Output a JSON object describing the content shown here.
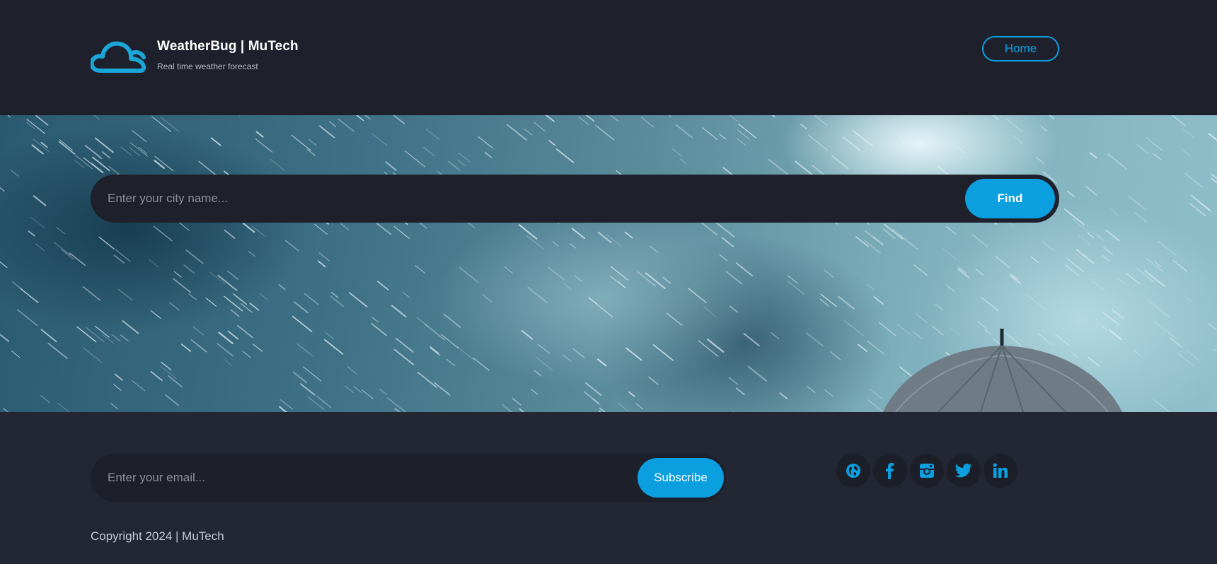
{
  "header": {
    "brand_title": "WeatherBug | MuTech",
    "brand_subtitle": "Real time weather forecast",
    "logo_icon": "cloud-icon",
    "nav_home": "Home"
  },
  "search": {
    "placeholder": "Enter your city name...",
    "button": "Find"
  },
  "newsletter": {
    "placeholder": "Enter your email...",
    "button": "Subscribe"
  },
  "socials": [
    {
      "icon": "globe-icon"
    },
    {
      "icon": "facebook-icon"
    },
    {
      "icon": "instagram-icon"
    },
    {
      "icon": "twitter-icon"
    },
    {
      "icon": "linkedin-icon"
    }
  ],
  "footer": {
    "copyright": "Copyright 2024 | MuTech"
  },
  "colors": {
    "accent": "#0b9fdf",
    "header_bg": "#1e202c",
    "footer_bg": "#232733"
  }
}
